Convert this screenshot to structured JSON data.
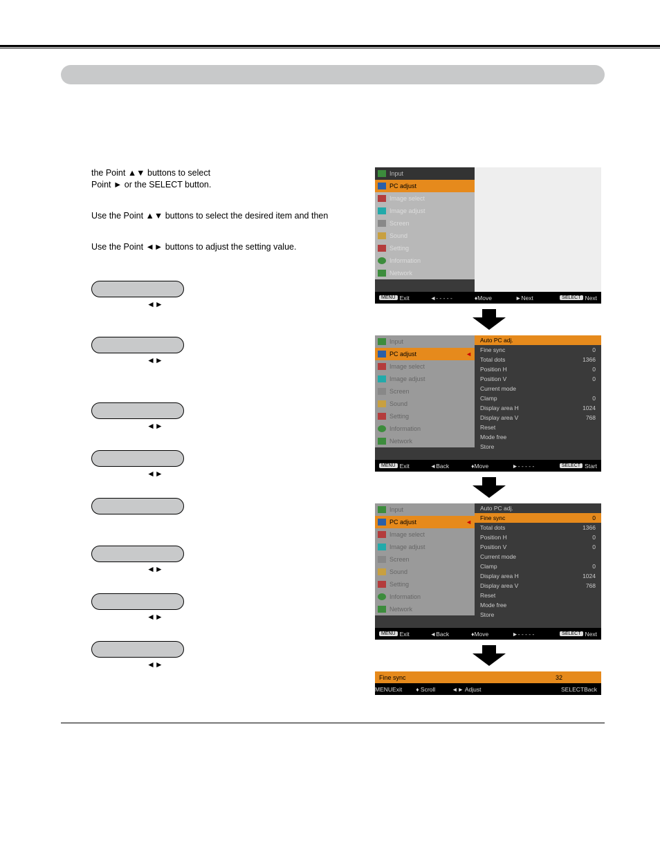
{
  "instructions": {
    "para1a": "the Point ▲▼ buttons to select",
    "para1b": "Point ► or the SELECT button.",
    "para2": "Use the Point ▲▼ buttons to select the desired item and then",
    "para3": "Use the Point ◄► buttons to adjust the setting value."
  },
  "pills": [
    {
      "sub": "◄►"
    },
    {
      "sub": "◄►"
    },
    {
      "sub": "◄►"
    },
    {
      "sub": "◄►"
    },
    {
      "sub": ""
    },
    {
      "sub": "◄►"
    },
    {
      "sub": "◄►"
    },
    {
      "sub": "◄►"
    }
  ],
  "osd": {
    "menu": [
      {
        "label": "Input",
        "icon": "ic-green",
        "class": "top"
      },
      {
        "label": "PC adjust",
        "icon": "ic-blue",
        "class": "sel",
        "arrow": "►"
      },
      {
        "label": "Image select",
        "icon": "ic-red",
        "class": ""
      },
      {
        "label": "Image adjust",
        "icon": "ic-teal",
        "class": ""
      },
      {
        "label": "Screen",
        "icon": "ic-grey",
        "class": ""
      },
      {
        "label": "Sound",
        "icon": "ic-goldr",
        "class": ""
      },
      {
        "label": "Setting",
        "icon": "ic-red",
        "class": ""
      },
      {
        "label": "Information",
        "icon": "ic-info",
        "class": ""
      },
      {
        "label": "Network",
        "icon": "ic-green",
        "class": ""
      }
    ],
    "menu_dim": [
      {
        "label": "Input",
        "icon": "ic-green",
        "class": "top dim"
      },
      {
        "label": "PC adjust",
        "icon": "ic-blue",
        "class": "sel",
        "arrow": "◄"
      },
      {
        "label": "Image select",
        "icon": "ic-red",
        "class": "dim"
      },
      {
        "label": "Image adjust",
        "icon": "ic-teal",
        "class": "dim"
      },
      {
        "label": "Screen",
        "icon": "ic-grey",
        "class": "dim"
      },
      {
        "label": "Sound",
        "icon": "ic-goldr",
        "class": "dim"
      },
      {
        "label": "Setting",
        "icon": "ic-red",
        "class": "dim"
      },
      {
        "label": "Information",
        "icon": "ic-info",
        "class": "dim"
      },
      {
        "label": "Network",
        "icon": "ic-green",
        "class": "dim"
      }
    ],
    "params": [
      {
        "name": "Auto PC adj.",
        "val": ""
      },
      {
        "name": "Fine sync",
        "val": "0"
      },
      {
        "name": "Total dots",
        "val": "1366"
      },
      {
        "name": "Position H",
        "val": "0"
      },
      {
        "name": "Position V",
        "val": "0"
      },
      {
        "name": "Current mode",
        "val": ""
      },
      {
        "name": "Clamp",
        "val": "0"
      },
      {
        "name": "Display area H",
        "val": "1024"
      },
      {
        "name": "Display area V",
        "val": "768"
      },
      {
        "name": "Reset",
        "val": ""
      },
      {
        "name": "Mode free",
        "val": ""
      },
      {
        "name": "Store",
        "val": ""
      }
    ],
    "bottom1": {
      "exit": "Exit",
      "b2": "- - - - -",
      "b3": "Move",
      "b4": "Next",
      "b5": "Next",
      "tag1": "MENU",
      "tag5": "SELECT"
    },
    "bottom2": {
      "exit": "Exit",
      "b2": "Back",
      "b3": "Move",
      "b4": "- - - - -",
      "b5": "Start",
      "tag1": "MENU",
      "tag5": "SELECT"
    },
    "bottom3": {
      "exit": "Exit",
      "b2": "Back",
      "b3": "Move",
      "b4": "- - - - -",
      "b5": "Next",
      "tag1": "MENU",
      "tag5": "SELECT"
    },
    "finesync": {
      "label": "Fine sync",
      "val": "32"
    },
    "bottom4": {
      "exit": "Exit",
      "b2": "Scroll",
      "b3": "Adjust",
      "b4": "Back",
      "tag1": "MENU",
      "tag4": "SELECT"
    }
  },
  "glyphs": {
    "updown": "▲▼",
    "right": "►",
    "left": "◄",
    "lr": "◄►",
    "ud": "♦"
  }
}
